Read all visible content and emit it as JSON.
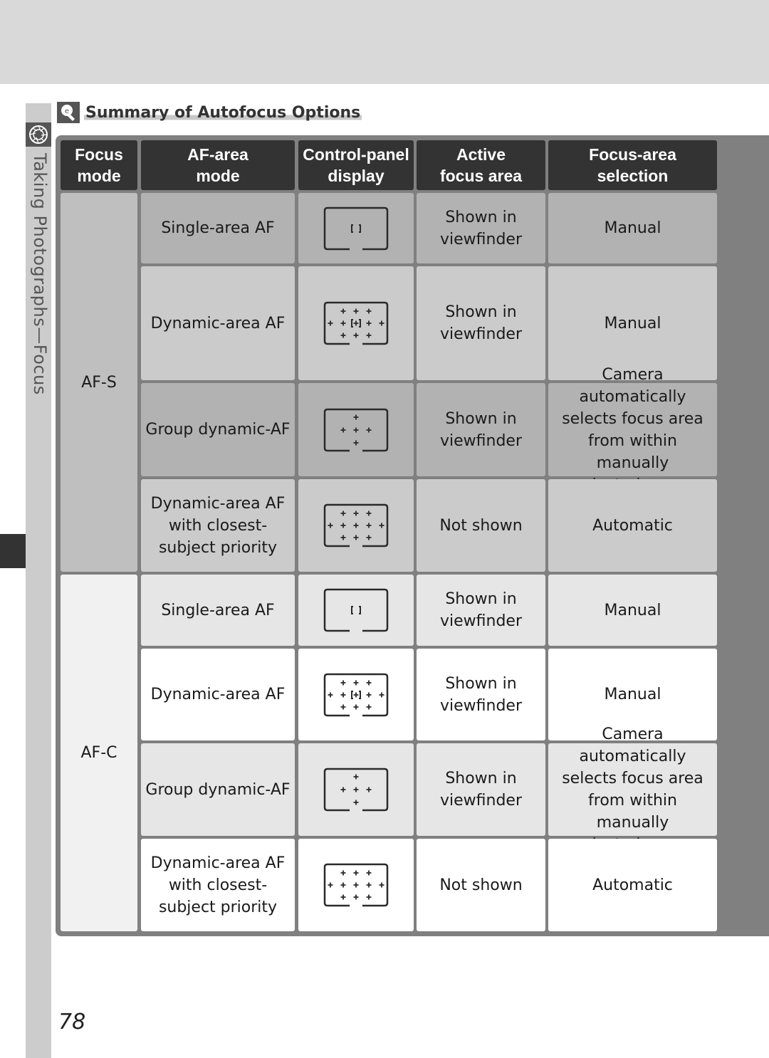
{
  "side_tab": {
    "label": "Taking Photographs—Focus",
    "icon": "aperture-icon"
  },
  "section": {
    "title": "Summary of Autofocus Options",
    "icon": "tip-bulb-icon"
  },
  "table": {
    "headers": [
      "Focus\nmode",
      "AF-area\nmode",
      "Control-panel\ndisplay",
      "Active\nfocus area",
      "Focus-area\nselection"
    ],
    "groups": [
      {
        "focus_mode": "AF-S",
        "rows": [
          {
            "af_area_mode": "Single-area AF",
            "display_icon": "single-area-icon",
            "active_focus_area": "Shown in viewfinder",
            "selection": "Manual"
          },
          {
            "af_area_mode": "Dynamic-area AF",
            "display_icon": "dynamic-area-icon",
            "active_focus_area": "Shown in viewfinder",
            "selection": "Manual"
          },
          {
            "af_area_mode": "Group dynamic-AF",
            "display_icon": "group-dynamic-icon",
            "active_focus_area": "Shown in viewfinder",
            "selection": "Camera automatically selects focus area from within manually selected group"
          },
          {
            "af_area_mode": "Dynamic-area AF with closest-subject priority",
            "display_icon": "closest-subject-icon",
            "active_focus_area": "Not shown",
            "selection": "Automatic"
          }
        ]
      },
      {
        "focus_mode": "AF-C",
        "rows": [
          {
            "af_area_mode": "Single-area AF",
            "display_icon": "single-area-icon",
            "active_focus_area": "Shown in viewfinder",
            "selection": "Manual"
          },
          {
            "af_area_mode": "Dynamic-area AF",
            "display_icon": "dynamic-area-icon",
            "active_focus_area": "Shown in viewfinder",
            "selection": "Manual"
          },
          {
            "af_area_mode": "Group dynamic-AF",
            "display_icon": "group-dynamic-icon",
            "active_focus_area": "Shown in viewfinder",
            "selection": "Camera automatically selects focus area from within manually selected group"
          },
          {
            "af_area_mode": "Dynamic-area AF with closest-subject priority",
            "display_icon": "closest-subject-icon",
            "active_focus_area": "Not shown",
            "selection": "Automatic"
          }
        ]
      }
    ]
  },
  "page_number": "78"
}
